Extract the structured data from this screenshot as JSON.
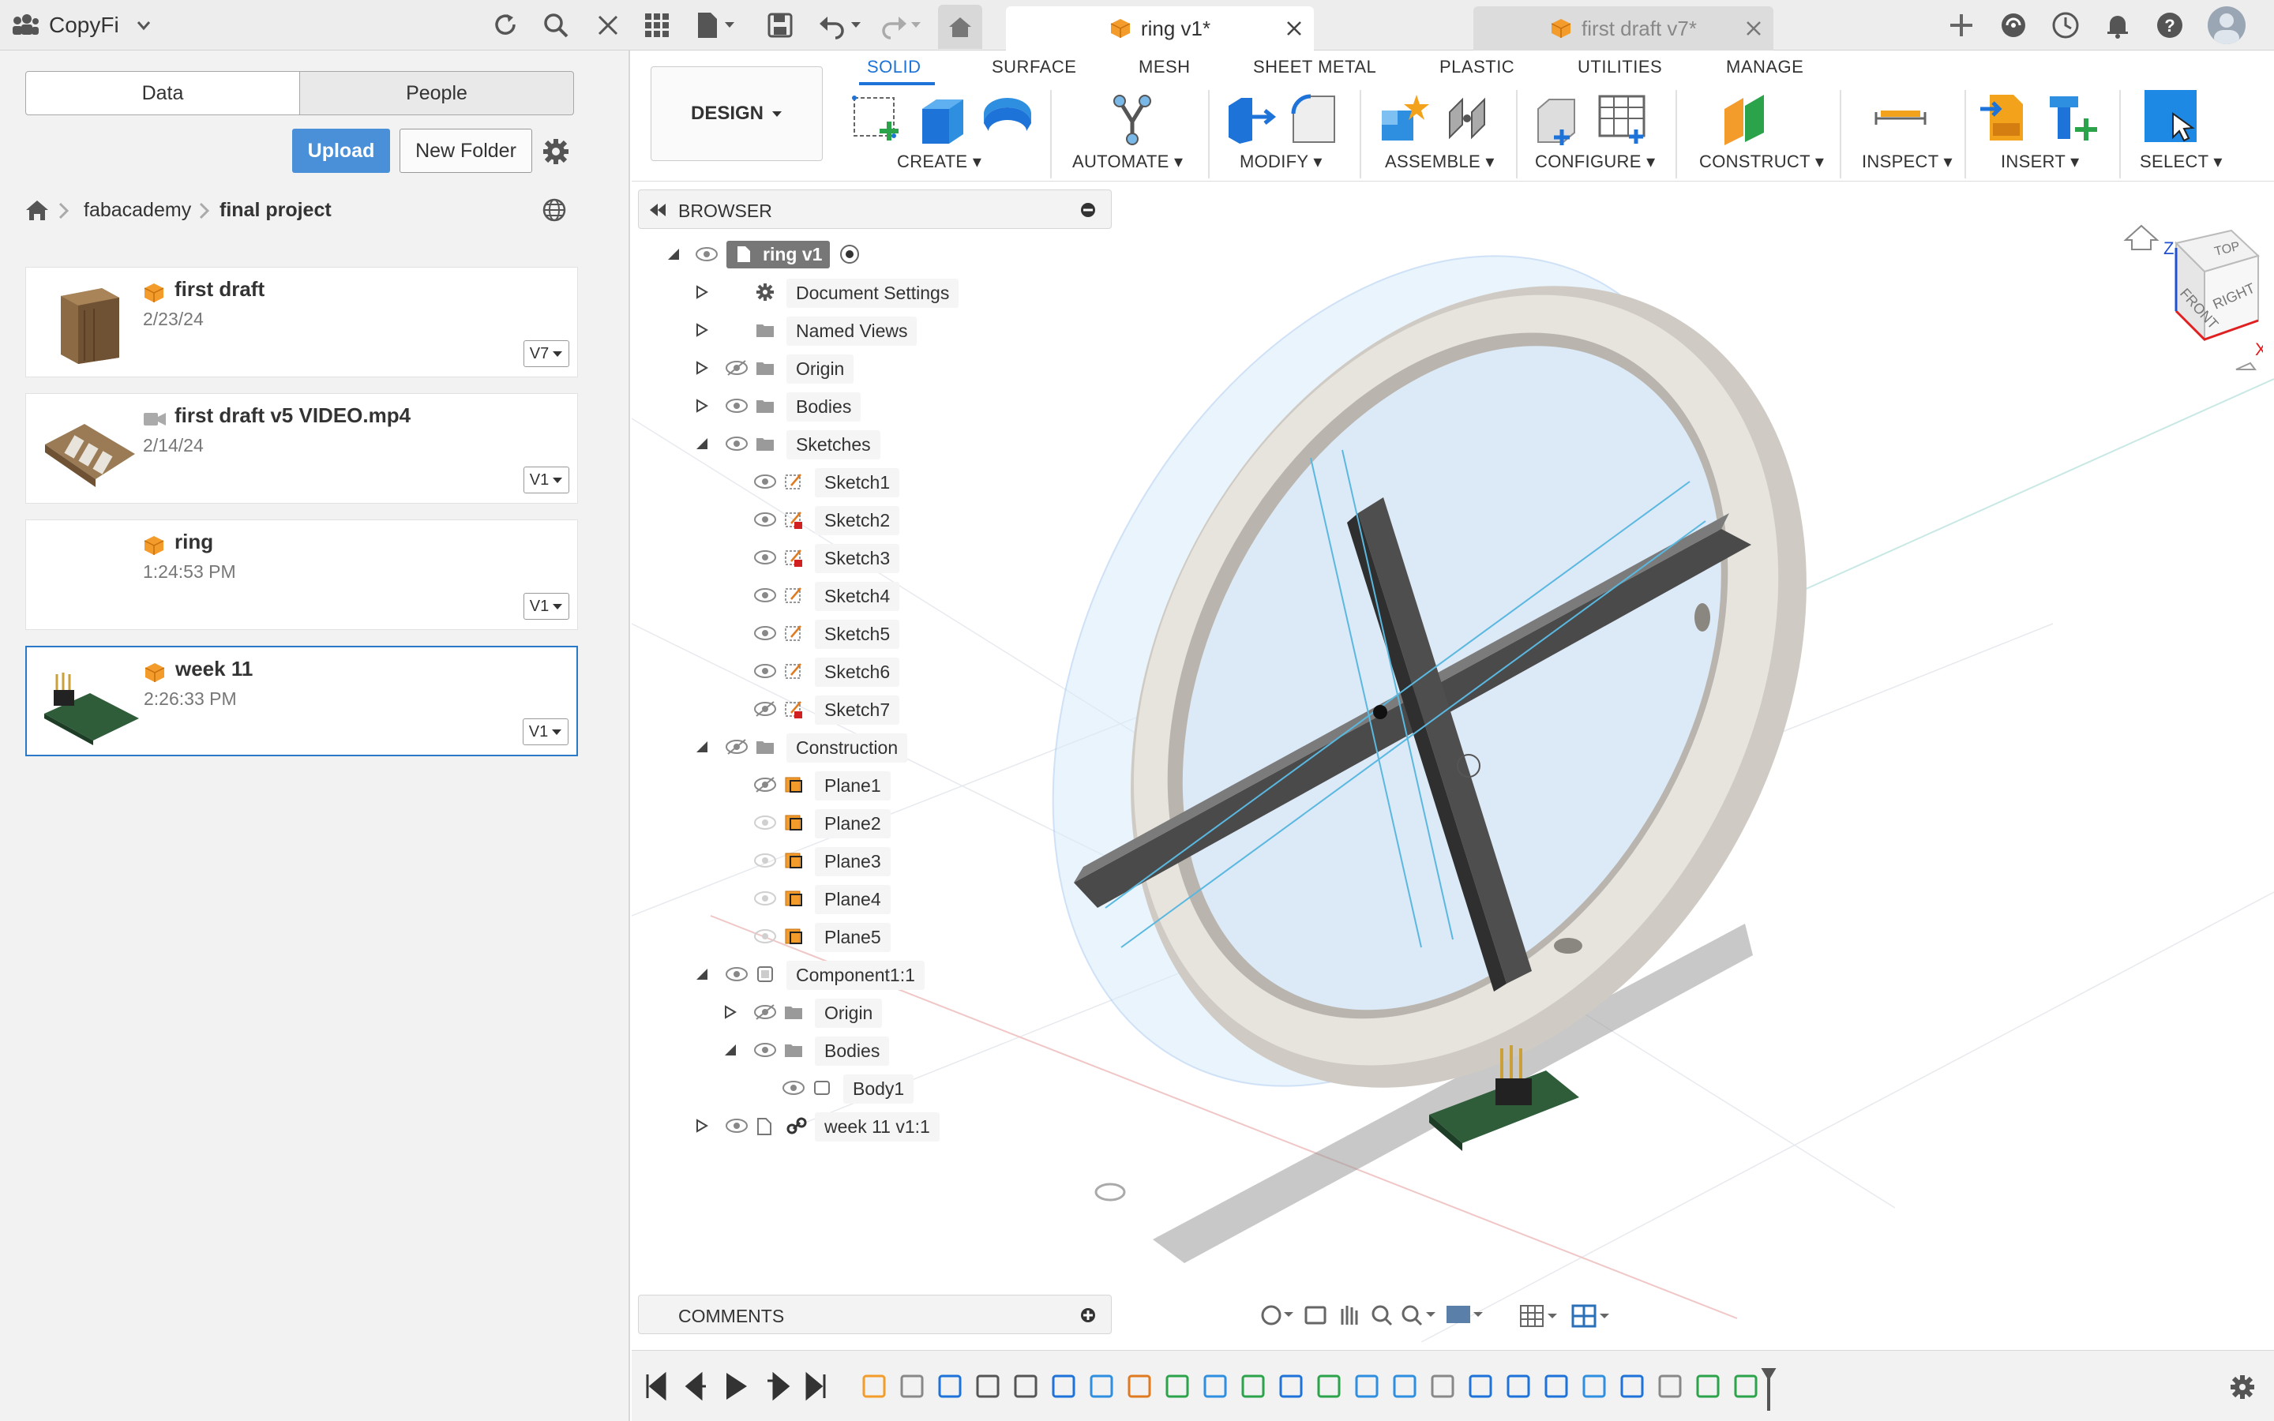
{
  "app": {
    "name": "CopyFi"
  },
  "data_panel": {
    "tabs": [
      "Data",
      "People"
    ],
    "upload_label": "Upload",
    "new_folder_label": "New Folder",
    "breadcrumb": [
      "fabacademy",
      "final project"
    ],
    "items": [
      {
        "title": "first draft",
        "date": "2/23/24",
        "version": "V7",
        "icon": "design-cube-icon",
        "thumb": "wood-box"
      },
      {
        "title": "first draft v5 VIDEO.mp4",
        "date": "2/14/24",
        "version": "V1",
        "icon": "video-icon",
        "thumb": "video"
      },
      {
        "title": "ring",
        "date": "1:24:53 PM",
        "version": "V1",
        "icon": "design-cube-icon",
        "thumb": "blank"
      },
      {
        "title": "week 11",
        "date": "2:26:33 PM",
        "version": "V1",
        "icon": "design-cube-icon",
        "thumb": "pcb"
      }
    ]
  },
  "doc_tabs": [
    {
      "label": "ring v1*",
      "active": true
    },
    {
      "label": "first draft v7*",
      "active": false
    }
  ],
  "ribbon": {
    "workspace": "DESIGN",
    "tabs": [
      "SOLID",
      "SURFACE",
      "MESH",
      "SHEET METAL",
      "PLASTIC",
      "UTILITIES",
      "MANAGE"
    ],
    "active_tab": "SOLID",
    "groups": [
      "CREATE",
      "AUTOMATE",
      "MODIFY",
      "ASSEMBLE",
      "CONFIGURE",
      "CONSTRUCT",
      "INSPECT",
      "INSERT",
      "SELECT"
    ]
  },
  "browser": {
    "title": "BROWSER",
    "root": "ring v1",
    "rows": [
      {
        "label": "Document Settings",
        "indent": 1,
        "icon": "gear-icon",
        "expand": "closed",
        "eye": "none"
      },
      {
        "label": "Named Views",
        "indent": 1,
        "icon": "folder-icon",
        "expand": "closed",
        "eye": "none"
      },
      {
        "label": "Origin",
        "indent": 1,
        "icon": "folder-icon",
        "expand": "closed",
        "eye": "hidden"
      },
      {
        "label": "Bodies",
        "indent": 1,
        "icon": "folder-icon",
        "expand": "closed",
        "eye": "visible"
      },
      {
        "label": "Sketches",
        "indent": 1,
        "icon": "folder-icon",
        "expand": "open",
        "eye": "visible"
      },
      {
        "label": "Sketch1",
        "indent": 2,
        "icon": "sketch-icon",
        "expand": "none",
        "eye": "visible"
      },
      {
        "label": "Sketch2",
        "indent": 2,
        "icon": "sketch-lock-icon",
        "expand": "none",
        "eye": "visible"
      },
      {
        "label": "Sketch3",
        "indent": 2,
        "icon": "sketch-lock-icon",
        "expand": "none",
        "eye": "visible"
      },
      {
        "label": "Sketch4",
        "indent": 2,
        "icon": "sketch-icon",
        "expand": "none",
        "eye": "visible"
      },
      {
        "label": "Sketch5",
        "indent": 2,
        "icon": "sketch-icon",
        "expand": "none",
        "eye": "visible"
      },
      {
        "label": "Sketch6",
        "indent": 2,
        "icon": "sketch-icon",
        "expand": "none",
        "eye": "visible"
      },
      {
        "label": "Sketch7",
        "indent": 2,
        "icon": "sketch-lock-icon",
        "expand": "none",
        "eye": "hidden"
      },
      {
        "label": "Construction",
        "indent": 1,
        "icon": "folder-icon",
        "expand": "open",
        "eye": "hidden"
      },
      {
        "label": "Plane1",
        "indent": 2,
        "icon": "plane-icon",
        "expand": "none",
        "eye": "hidden"
      },
      {
        "label": "Plane2",
        "indent": 2,
        "icon": "plane-icon",
        "expand": "none",
        "eye": "faint"
      },
      {
        "label": "Plane3",
        "indent": 2,
        "icon": "plane-icon",
        "expand": "none",
        "eye": "faint"
      },
      {
        "label": "Plane4",
        "indent": 2,
        "icon": "plane-icon",
        "expand": "none",
        "eye": "faint"
      },
      {
        "label": "Plane5",
        "indent": 2,
        "icon": "plane-icon",
        "expand": "none",
        "eye": "faint"
      },
      {
        "label": "Component1:1",
        "indent": 1,
        "icon": "component-icon",
        "expand": "open",
        "eye": "visible"
      },
      {
        "label": "Origin",
        "indent": 2,
        "icon": "folder-icon",
        "expand": "closed",
        "eye": "hidden"
      },
      {
        "label": "Bodies",
        "indent": 2,
        "icon": "folder-icon",
        "expand": "open",
        "eye": "visible"
      },
      {
        "label": "Body1",
        "indent": 3,
        "icon": "body-icon",
        "expand": "none",
        "eye": "visible"
      },
      {
        "label": "week 11 v1:1",
        "indent": 1,
        "icon": "linked-component-icon",
        "expand": "closed",
        "eye": "visible"
      }
    ]
  },
  "comments": {
    "title": "COMMENTS"
  },
  "viewcube": {
    "top": "TOP",
    "front": "FRONT",
    "right": "RIGHT",
    "x": "X",
    "z": "Z"
  },
  "colors": {
    "accent": "#1e73d8",
    "upload": "#4a90d9",
    "ring": "#d9d6d0",
    "cross": "#555555",
    "pcb": "#2f5d3a"
  }
}
